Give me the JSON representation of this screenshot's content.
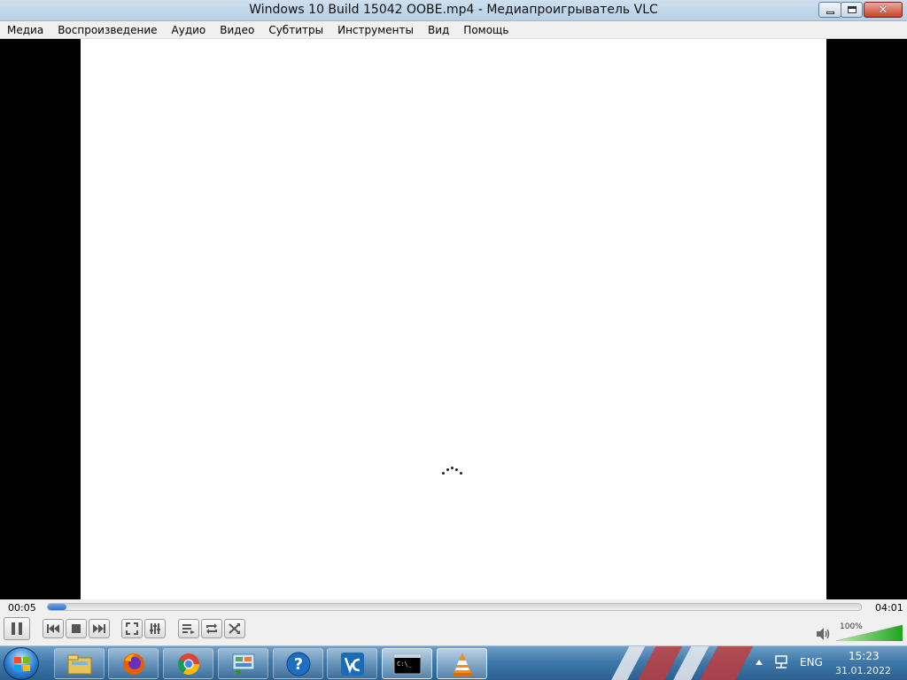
{
  "window": {
    "title": "Windows 10 Build 15042 OOBE.mp4 - Медиапроигрыватель VLC",
    "minimize_glyph": "—",
    "close_glyph": "✕"
  },
  "menu": {
    "items": [
      {
        "label": "Медиа"
      },
      {
        "label": "Воспроизведение"
      },
      {
        "label": "Аудио"
      },
      {
        "label": "Видео"
      },
      {
        "label": "Субтитры"
      },
      {
        "label": "Инструменты"
      },
      {
        "label": "Вид"
      },
      {
        "label": "Помощь"
      }
    ]
  },
  "player": {
    "current_time": "00:05",
    "total_time": "04:01",
    "progress_fraction": 0.021,
    "volume_label": "100%",
    "volume_fraction": 1.0,
    "accent_color": "#2f74c7",
    "state": "playing"
  },
  "taskbar": {
    "apps": [
      {
        "icon": "file-explorer-icon"
      },
      {
        "icon": "firefox-icon"
      },
      {
        "icon": "chrome-icon"
      },
      {
        "icon": "control-panel-icon"
      },
      {
        "icon": "help-icon"
      },
      {
        "icon": "vscode-icon"
      },
      {
        "icon": "command-prompt-icon"
      },
      {
        "icon": "vlc-icon"
      }
    ],
    "tray": {
      "language": "ENG",
      "time": "15:23",
      "date": "31.01.2022",
      "cmd_label": "C:\\_"
    },
    "help_glyph": "?"
  }
}
